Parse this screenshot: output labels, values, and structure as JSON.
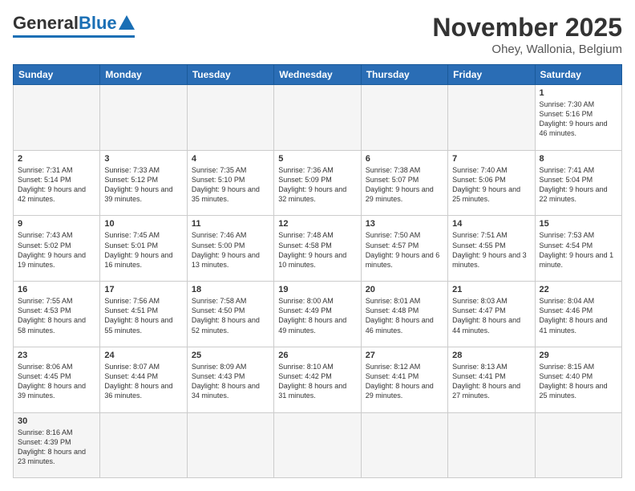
{
  "header": {
    "logo": {
      "general": "General",
      "blue": "Blue"
    },
    "title": "November 2025",
    "location": "Ohey, Wallonia, Belgium"
  },
  "days_of_week": [
    "Sunday",
    "Monday",
    "Tuesday",
    "Wednesday",
    "Thursday",
    "Friday",
    "Saturday"
  ],
  "weeks": [
    [
      {
        "day": null,
        "info": null
      },
      {
        "day": null,
        "info": null
      },
      {
        "day": null,
        "info": null
      },
      {
        "day": null,
        "info": null
      },
      {
        "day": null,
        "info": null
      },
      {
        "day": null,
        "info": null
      },
      {
        "day": "1",
        "info": "Sunrise: 7:30 AM\nSunset: 5:16 PM\nDaylight: 9 hours and 46 minutes."
      }
    ],
    [
      {
        "day": "2",
        "info": "Sunrise: 7:31 AM\nSunset: 5:14 PM\nDaylight: 9 hours and 42 minutes."
      },
      {
        "day": "3",
        "info": "Sunrise: 7:33 AM\nSunset: 5:12 PM\nDaylight: 9 hours and 39 minutes."
      },
      {
        "day": "4",
        "info": "Sunrise: 7:35 AM\nSunset: 5:10 PM\nDaylight: 9 hours and 35 minutes."
      },
      {
        "day": "5",
        "info": "Sunrise: 7:36 AM\nSunset: 5:09 PM\nDaylight: 9 hours and 32 minutes."
      },
      {
        "day": "6",
        "info": "Sunrise: 7:38 AM\nSunset: 5:07 PM\nDaylight: 9 hours and 29 minutes."
      },
      {
        "day": "7",
        "info": "Sunrise: 7:40 AM\nSunset: 5:06 PM\nDaylight: 9 hours and 25 minutes."
      },
      {
        "day": "8",
        "info": "Sunrise: 7:41 AM\nSunset: 5:04 PM\nDaylight: 9 hours and 22 minutes."
      }
    ],
    [
      {
        "day": "9",
        "info": "Sunrise: 7:43 AM\nSunset: 5:02 PM\nDaylight: 9 hours and 19 minutes."
      },
      {
        "day": "10",
        "info": "Sunrise: 7:45 AM\nSunset: 5:01 PM\nDaylight: 9 hours and 16 minutes."
      },
      {
        "day": "11",
        "info": "Sunrise: 7:46 AM\nSunset: 5:00 PM\nDaylight: 9 hours and 13 minutes."
      },
      {
        "day": "12",
        "info": "Sunrise: 7:48 AM\nSunset: 4:58 PM\nDaylight: 9 hours and 10 minutes."
      },
      {
        "day": "13",
        "info": "Sunrise: 7:50 AM\nSunset: 4:57 PM\nDaylight: 9 hours and 6 minutes."
      },
      {
        "day": "14",
        "info": "Sunrise: 7:51 AM\nSunset: 4:55 PM\nDaylight: 9 hours and 3 minutes."
      },
      {
        "day": "15",
        "info": "Sunrise: 7:53 AM\nSunset: 4:54 PM\nDaylight: 9 hours and 1 minute."
      }
    ],
    [
      {
        "day": "16",
        "info": "Sunrise: 7:55 AM\nSunset: 4:53 PM\nDaylight: 8 hours and 58 minutes."
      },
      {
        "day": "17",
        "info": "Sunrise: 7:56 AM\nSunset: 4:51 PM\nDaylight: 8 hours and 55 minutes."
      },
      {
        "day": "18",
        "info": "Sunrise: 7:58 AM\nSunset: 4:50 PM\nDaylight: 8 hours and 52 minutes."
      },
      {
        "day": "19",
        "info": "Sunrise: 8:00 AM\nSunset: 4:49 PM\nDaylight: 8 hours and 49 minutes."
      },
      {
        "day": "20",
        "info": "Sunrise: 8:01 AM\nSunset: 4:48 PM\nDaylight: 8 hours and 46 minutes."
      },
      {
        "day": "21",
        "info": "Sunrise: 8:03 AM\nSunset: 4:47 PM\nDaylight: 8 hours and 44 minutes."
      },
      {
        "day": "22",
        "info": "Sunrise: 8:04 AM\nSunset: 4:46 PM\nDaylight: 8 hours and 41 minutes."
      }
    ],
    [
      {
        "day": "23",
        "info": "Sunrise: 8:06 AM\nSunset: 4:45 PM\nDaylight: 8 hours and 39 minutes."
      },
      {
        "day": "24",
        "info": "Sunrise: 8:07 AM\nSunset: 4:44 PM\nDaylight: 8 hours and 36 minutes."
      },
      {
        "day": "25",
        "info": "Sunrise: 8:09 AM\nSunset: 4:43 PM\nDaylight: 8 hours and 34 minutes."
      },
      {
        "day": "26",
        "info": "Sunrise: 8:10 AM\nSunset: 4:42 PM\nDaylight: 8 hours and 31 minutes."
      },
      {
        "day": "27",
        "info": "Sunrise: 8:12 AM\nSunset: 4:41 PM\nDaylight: 8 hours and 29 minutes."
      },
      {
        "day": "28",
        "info": "Sunrise: 8:13 AM\nSunset: 4:41 PM\nDaylight: 8 hours and 27 minutes."
      },
      {
        "day": "29",
        "info": "Sunrise: 8:15 AM\nSunset: 4:40 PM\nDaylight: 8 hours and 25 minutes."
      }
    ],
    [
      {
        "day": "30",
        "info": "Sunrise: 8:16 AM\nSunset: 4:39 PM\nDaylight: 8 hours and 23 minutes."
      },
      {
        "day": null,
        "info": null
      },
      {
        "day": null,
        "info": null
      },
      {
        "day": null,
        "info": null
      },
      {
        "day": null,
        "info": null
      },
      {
        "day": null,
        "info": null
      },
      {
        "day": null,
        "info": null
      }
    ]
  ]
}
